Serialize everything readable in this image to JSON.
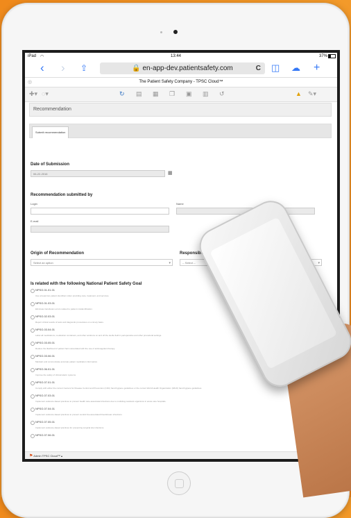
{
  "status_bar": {
    "device": "iPad",
    "wifi": "wifi-icon",
    "time": "13:44",
    "battery": "37%"
  },
  "browser": {
    "url": "en-app-dev.patientsafety.com",
    "page_title": "The Patient Safety Company - TPSC Cloud™"
  },
  "panel": {
    "title": "Recommendation",
    "tab": "Submit recommendation"
  },
  "date_section": {
    "title": "Date of Submission",
    "value": "06-22-2016"
  },
  "submitted_by": {
    "title": "Recommendation submitted by",
    "login_label": "Login",
    "name_label": "Name",
    "email_label": "E-mail"
  },
  "origin": {
    "title": "Origin of Recommendation",
    "placeholder": "Select an option"
  },
  "department": {
    "title": "Responsible Department",
    "placeholder": "-- Select --"
  },
  "goals": {
    "title": "Is related with the following National Patient Safety Goal",
    "items": [
      {
        "code": "NPSG.01.01.01",
        "desc": "Use at least two patient identifiers when providing care, treatment, and services."
      },
      {
        "code": "NPSG.01.03.01",
        "desc": "Eliminate transfusion errors related to patient misidentification."
      },
      {
        "code": "NPSG.02.03.01",
        "desc": "Report critical results of tests and diagnostic procedures on a timely basis."
      },
      {
        "code": "NPSG.03.04.01",
        "desc": "Label all medications, medication containers, and other solutions on and off the sterile field in perioperative and other procedural settings."
      },
      {
        "code": "NPSG.03.05.01",
        "desc": "Reduce the likelihood of patient harm associated with the use of anticoagulant therapy."
      },
      {
        "code": "NPSG.03.06.01",
        "desc": "Maintain and communicate accurate patient medication information."
      },
      {
        "code": "NPSG.06.01.01",
        "desc": "Improve the safety of clinical alarm systems."
      },
      {
        "code": "NPSG.07.01.01",
        "desc": "Comply with either the current Centers for Disease Control and Prevention (CDC) hand hygiene guidelines or the current World Health Organization (WHO) hand hygiene guidelines."
      },
      {
        "code": "NPSG.07.03.01",
        "desc": "Implement evidence-based practices to prevent health care-associated infections due to multidrug-resistant organisms in acute care hospitals."
      },
      {
        "code": "NPSG.07.04.01",
        "desc": "Implement evidence-based practices to prevent central line-associated bloodstream infections."
      },
      {
        "code": "NPSG.07.05.01",
        "desc": "Implement evidence-based practices for preventing surgical site infections."
      },
      {
        "code": "NPSG.07.06.01",
        "desc": ""
      }
    ]
  },
  "footer": {
    "user": "Admin TPSC Cloud™ ▴"
  }
}
